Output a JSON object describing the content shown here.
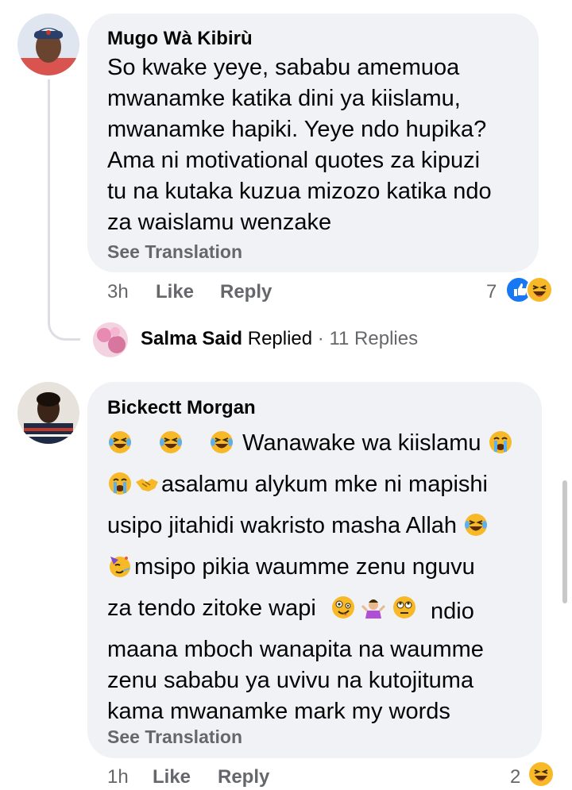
{
  "comments": [
    {
      "author": "Mugo Wà Kibirù",
      "lines": [
        "So kwake yeye, sababu amemuoa",
        "mwanamke katika dini ya kiislamu,",
        "mwanamke hapiki. Yeye ndo hupika?",
        "Ama ni motivational quotes za kipuzi",
        "tu na kutaka kuzua mizozo katika ndo",
        "za waislamu wenzake"
      ],
      "see_translation": "See Translation",
      "time": "3h",
      "like_label": "Like",
      "reply_label": "Reply",
      "reaction_count": "7",
      "reactions": [
        "like-icon",
        "haha-icon"
      ]
    },
    {
      "author": "Bickectt Morgan",
      "lines": [
        " Wanawake wa kiislamu ",
        "asalamu alykum mke ni mapishi",
        "usipo jitahidi wakristo masha Allah ",
        "msipo pikia waumme zenu nguvu",
        "za tendo zitoke wapi ndio",
        "maana mboch wanapita na waumme",
        "zenu sababu ya uvivu na kutojituma",
        "kama mwanamke mark my words"
      ],
      "see_translation": "See Translation",
      "time": "1h",
      "like_label": "Like",
      "reply_label": "Reply",
      "reaction_count": "2",
      "reactions": [
        "haha-icon"
      ]
    }
  ],
  "reply_summary": {
    "name": "Salma Said",
    "action": "Replied",
    "separator": "·",
    "count_text": "11 Replies"
  },
  "colors": {
    "bubble": "#f0f2f5",
    "meta": "#65676b",
    "like_blue": "#1877f2",
    "haha_yellow": "#f7b928"
  }
}
